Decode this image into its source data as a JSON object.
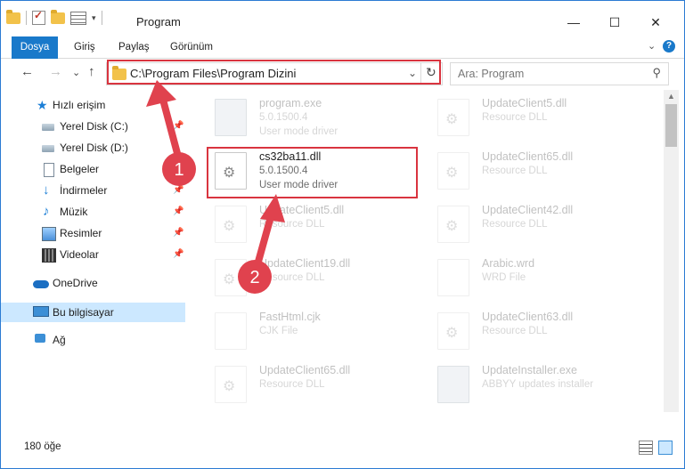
{
  "window": {
    "title": "Program",
    "minimize_glyph": "—",
    "maximize_glyph": "☐",
    "close_glyph": "✕"
  },
  "ribbon": {
    "tabs": [
      "Dosya",
      "Giriş",
      "Paylaş",
      "Görünüm"
    ],
    "expand_glyph": "⌄",
    "help_glyph": "?"
  },
  "nav": {
    "back_glyph": "←",
    "forward_glyph": "→",
    "recent_glyph": "⌄",
    "up_glyph": "↑",
    "address": "C:\\Program Files\\Program Dizini",
    "address_dropdown_glyph": "⌄",
    "refresh_glyph": "↻",
    "search_placeholder": "Ara: Program",
    "search_glyph": "⚲"
  },
  "sidebar": {
    "items": [
      {
        "label": "Hızlı erişim",
        "icon": "star-icon"
      },
      {
        "label": "Yerel Disk (C:)",
        "icon": "drive-icon"
      },
      {
        "label": "Yerel Disk (D:)",
        "icon": "drive-icon"
      },
      {
        "label": "Belgeler",
        "icon": "documents-icon"
      },
      {
        "label": "İndirmeler",
        "icon": "download-icon"
      },
      {
        "label": "Müzik",
        "icon": "music-icon"
      },
      {
        "label": "Resimler",
        "icon": "pictures-icon"
      },
      {
        "label": "Videolar",
        "icon": "videos-icon"
      },
      {
        "label": "OneDrive",
        "icon": "cloud-icon"
      },
      {
        "label": "Bu bilgisayar",
        "icon": "computer-icon"
      },
      {
        "label": "Ağ",
        "icon": "network-icon"
      }
    ],
    "pin_glyph": "📌"
  },
  "files": [
    {
      "name": "program.exe",
      "version": "5.0.1500.4",
      "type": "User mode driver"
    },
    {
      "name": "UpdateClient5.dll",
      "version": "",
      "type": "Resource DLL"
    },
    {
      "name": "cs32ba11.dll",
      "version": "5.0.1500.4",
      "type": "User mode driver"
    },
    {
      "name": "UpdateClient65.dll",
      "version": "",
      "type": "Resource DLL"
    },
    {
      "name": "UpdateClient5.dll",
      "version": "",
      "type": "Resource DLL"
    },
    {
      "name": "UpdateClient42.dll",
      "version": "",
      "type": "Resource DLL"
    },
    {
      "name": "UpdateClient19.dll",
      "version": "",
      "type": "Resource DLL"
    },
    {
      "name": "Arabic.wrd",
      "version": "",
      "type": "WRD File"
    },
    {
      "name": "FastHtml.cjk",
      "version": "",
      "type": "CJK File"
    },
    {
      "name": "UpdateClient63.dll",
      "version": "",
      "type": "Resource DLL"
    },
    {
      "name": "UpdateClient65.dll",
      "version": "",
      "type": "Resource DLL"
    },
    {
      "name": "UpdateInstaller.exe",
      "version": "",
      "type": "ABBYY updates installer"
    }
  ],
  "status": {
    "count": "180 öğe"
  },
  "annotations": {
    "step1": "1",
    "step2": "2",
    "highlight_color": "#d9343f",
    "arrow_color": "#e0424e"
  }
}
